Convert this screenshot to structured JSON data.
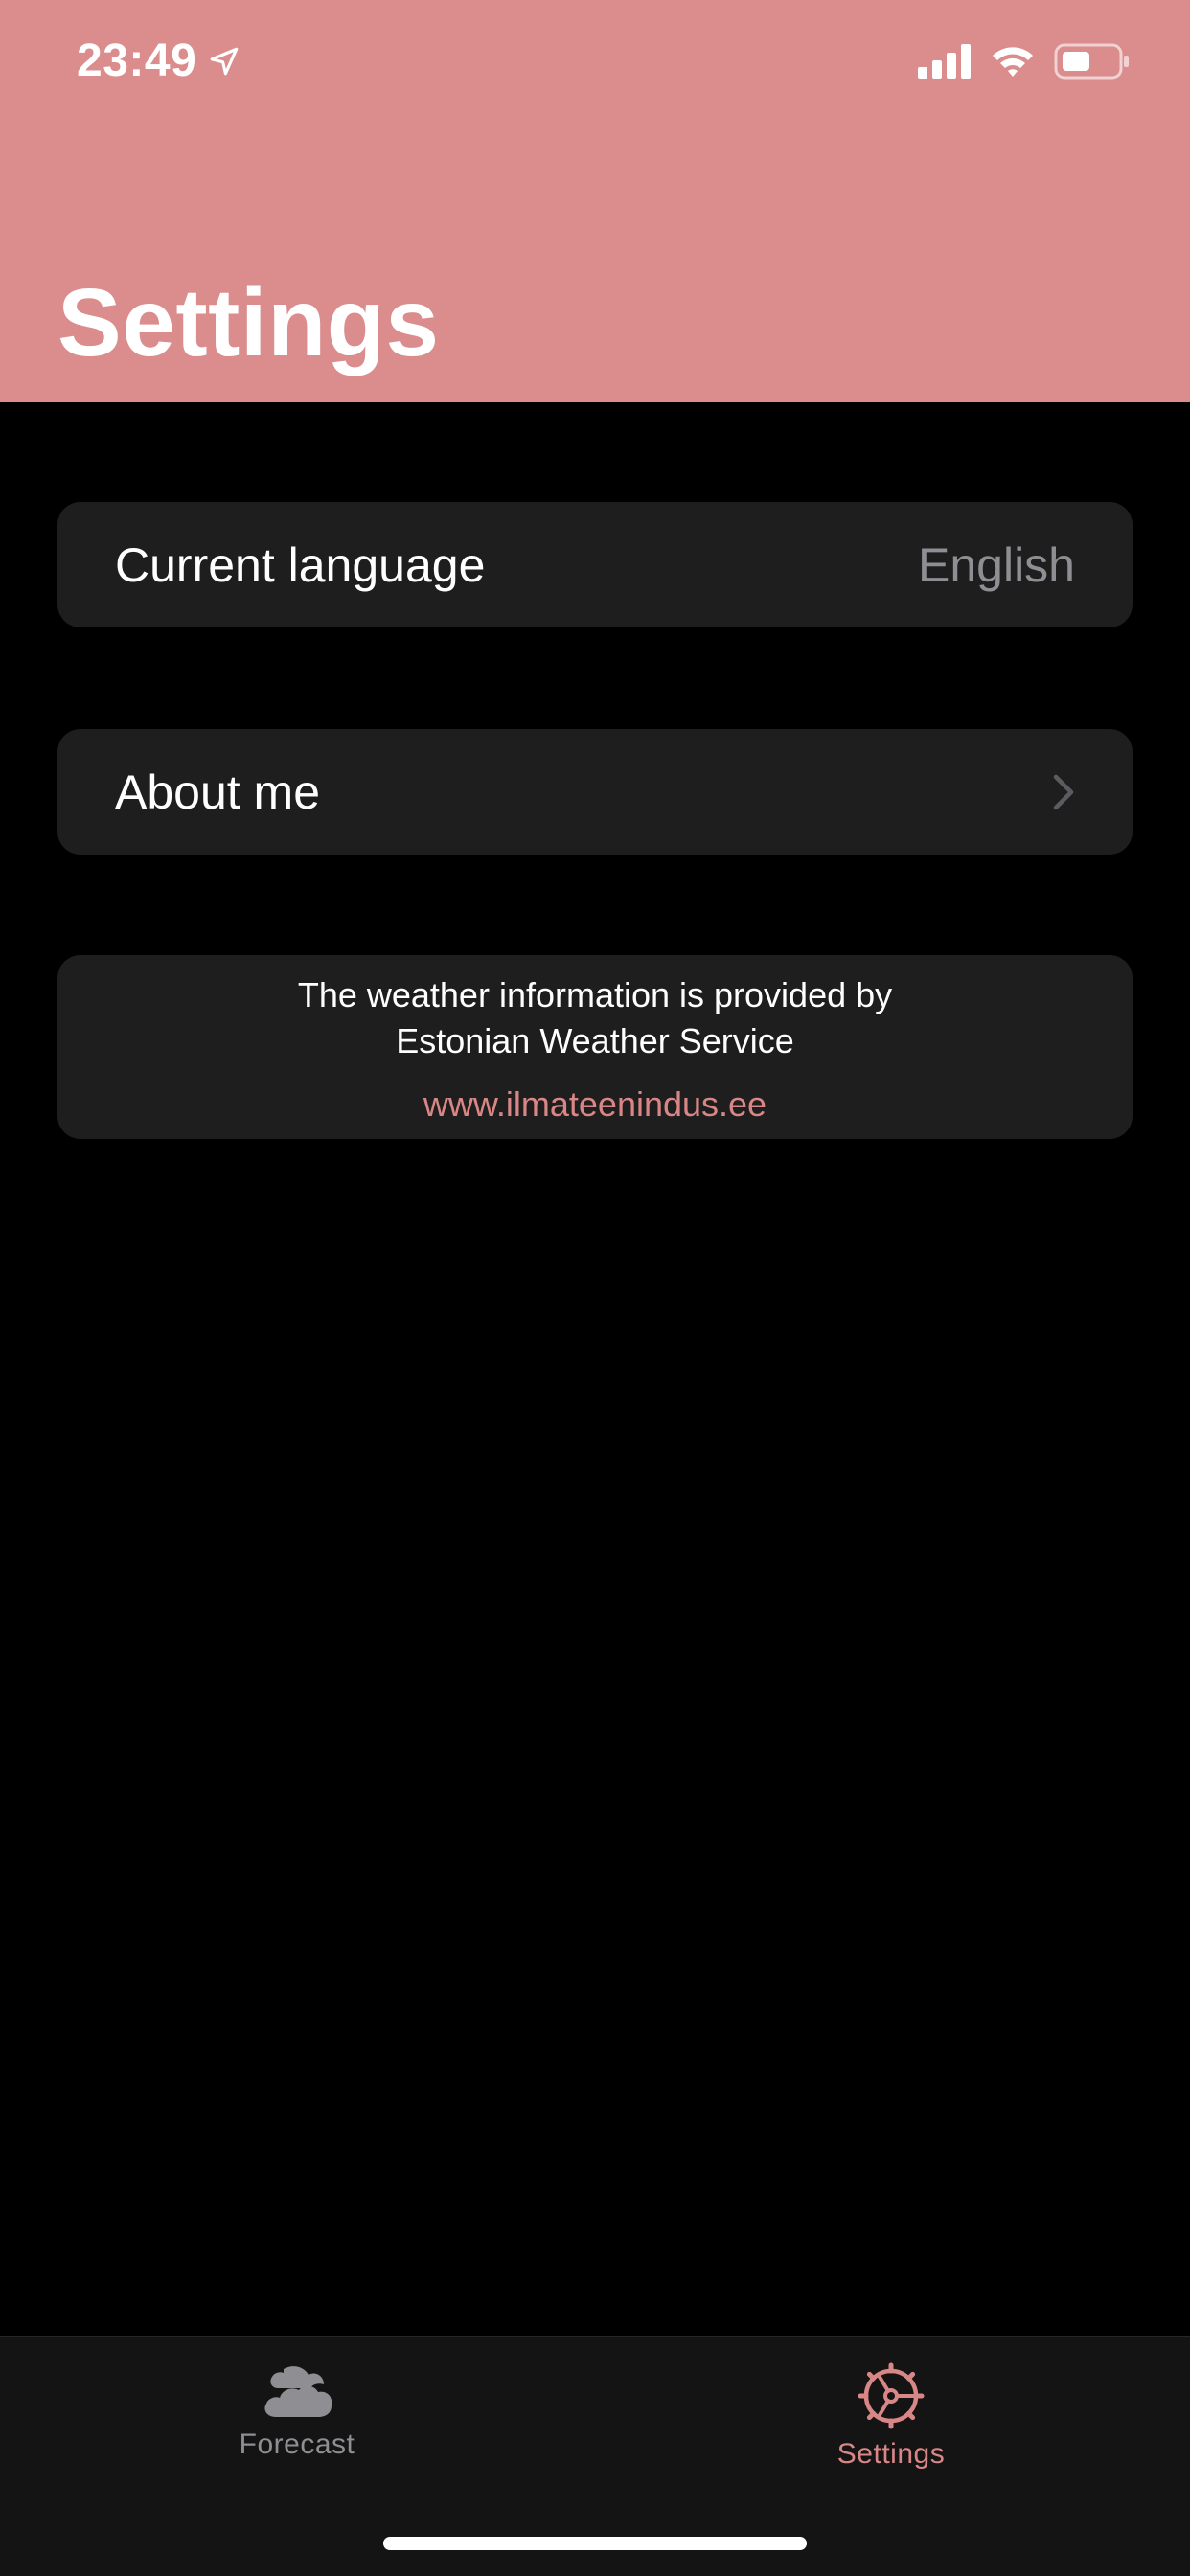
{
  "status_bar": {
    "time": "23:49",
    "icons": [
      "location-arrow-icon",
      "cellular-signal-icon",
      "wifi-icon",
      "battery-icon"
    ]
  },
  "header": {
    "title": "Settings",
    "background_color": "#db8c8c"
  },
  "settings": {
    "language_label": "Current language",
    "language_value": "English",
    "about_label": "About me"
  },
  "info": {
    "line1": "The weather information is provided by",
    "line2": "Estonian Weather Service",
    "link": "www.ilmateenindus.ee"
  },
  "tabbar": {
    "tabs": [
      {
        "label": "Forecast",
        "icon": "cloud-icon",
        "selected": false
      },
      {
        "label": "Settings",
        "icon": "gear-icon",
        "selected": true
      }
    ],
    "accent_color": "#d98686",
    "inactive_color": "#8e8e93"
  }
}
